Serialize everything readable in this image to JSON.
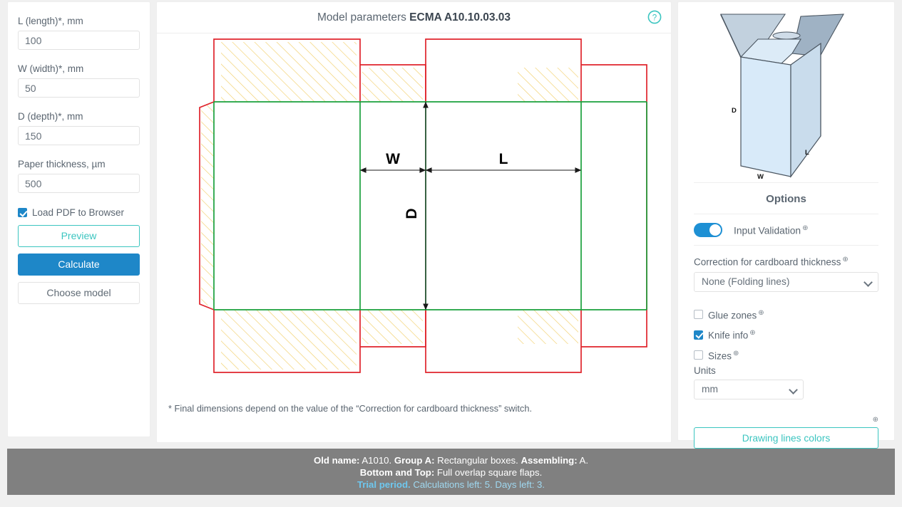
{
  "left_panel": {
    "fields": [
      {
        "label": "L (length)*, mm",
        "value": "100",
        "name": "length"
      },
      {
        "label": "W (width)*, mm",
        "value": "50",
        "name": "width"
      },
      {
        "label": "D (depth)*, mm",
        "value": "150",
        "name": "depth"
      },
      {
        "label": "Paper thickness, µm",
        "value": "500",
        "name": "thickness"
      }
    ],
    "load_pdf_label": "Load PDF to Browser",
    "load_pdf_checked": true,
    "preview_label": "Preview",
    "calculate_label": "Calculate",
    "choose_model_label": "Choose model"
  },
  "middle_panel": {
    "title_prefix": "Model parameters ",
    "title_model": "ECMA A10.10.03.03",
    "help_icon": "question-circle-icon",
    "footnote": "* Final dimensions depend on the value of the “Correction for cardboard thickness” switch.",
    "dieline": {
      "labels": {
        "w": "W",
        "l": "L",
        "d": "D"
      },
      "colors": {
        "cut": "#e0242c",
        "crease": "#1aa03c",
        "hatch": "#f2cf6a"
      }
    }
  },
  "right_panel": {
    "preview_labels": {
      "d": "D",
      "l": "L",
      "w": "W"
    },
    "options_title": "Options",
    "input_validation_label": "Input Validation",
    "input_validation_on": true,
    "correction_label": "Correction for cardboard thickness",
    "correction_value": "None (Folding lines)",
    "checks": [
      {
        "label": "Glue zones",
        "checked": false,
        "name": "glue-zones"
      },
      {
        "label": "Knife info",
        "checked": true,
        "name": "knife-info"
      },
      {
        "label": "Sizes",
        "checked": false,
        "name": "sizes"
      }
    ],
    "units_label": "Units",
    "units_value": "mm",
    "drawing_colors_label": "Drawing lines colors",
    "help_glyph": "⊕"
  },
  "status_bar": {
    "line1_a": "Old name:",
    "line1_b": " A1010. ",
    "line1_c": "Group A:",
    "line1_d": " Rectangular boxes. ",
    "line1_e": "Assembling:",
    "line1_f": " A.",
    "line2_a": "Bottom and Top:",
    "line2_b": " Full overlap square flaps.",
    "line3_a": "Trial period.",
    "line3_b": " Calculations left: 5. Days left: 3."
  }
}
